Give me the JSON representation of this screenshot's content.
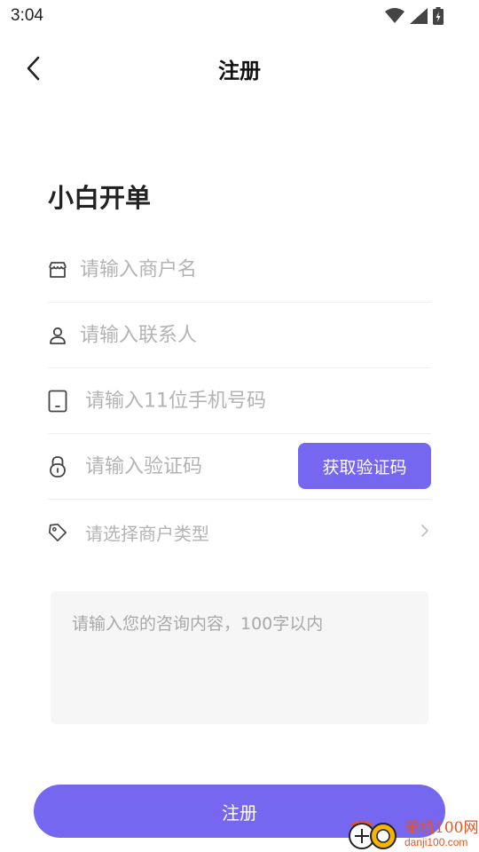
{
  "status_bar": {
    "time": "3:04"
  },
  "nav": {
    "title": "注册"
  },
  "brand": {
    "title": "小白开单"
  },
  "form": {
    "merchant_name_placeholder": "请输入商户名",
    "contact_placeholder": "请输入联系人",
    "phone_placeholder": "请输入11位手机号码",
    "code_placeholder": "请输入验证码",
    "get_code_label": "获取验证码",
    "merchant_type_label": "请选择商户类型",
    "consult_placeholder": "请输入您的咨询内容，100字以内",
    "submit_label": "注册"
  },
  "watermark": {
    "name": "单机100网",
    "url": "danji100.com"
  },
  "colors": {
    "accent": "#7567f0",
    "placeholder": "#b3b3b3",
    "divider": "#eeeeee",
    "watermark": "#e8531f"
  },
  "icons": [
    "wifi-icon",
    "signal-icon",
    "battery-icon",
    "back-arrow-icon",
    "store-icon",
    "person-icon",
    "phone-icon",
    "lock-icon",
    "tag-icon",
    "chevron-right-icon"
  ]
}
